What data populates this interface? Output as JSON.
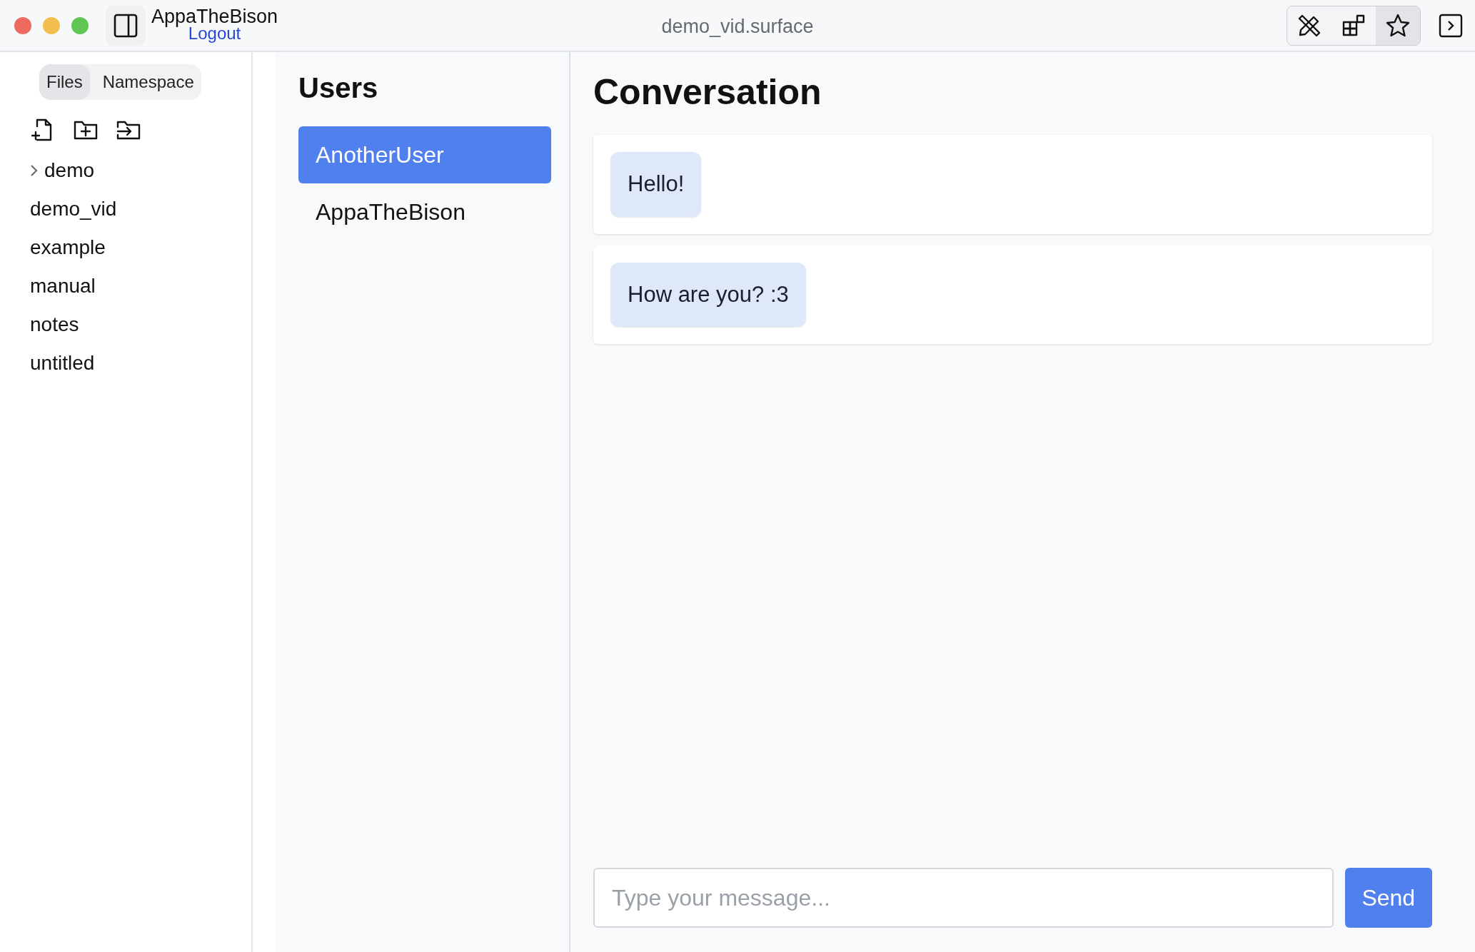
{
  "window": {
    "title": "demo_vid.surface"
  },
  "account": {
    "username": "AppaTheBison",
    "logout": "Logout"
  },
  "toolbar": [
    {
      "kind": "tools",
      "selected": false
    },
    {
      "kind": "widgets",
      "selected": false
    },
    {
      "kind": "star",
      "selected": true
    }
  ],
  "sidebar": {
    "tabs": [
      {
        "label": "Files",
        "selected": true
      },
      {
        "label": "Namespace",
        "selected": false
      }
    ],
    "actions": [
      {
        "kind": "new-file"
      },
      {
        "kind": "new-folder"
      },
      {
        "kind": "import"
      }
    ],
    "tree": [
      {
        "label": "demo",
        "kind": "folder",
        "expanded": false
      },
      {
        "label": "demo_vid",
        "kind": "file"
      },
      {
        "label": "example",
        "kind": "file"
      },
      {
        "label": "manual",
        "kind": "file"
      },
      {
        "label": "notes",
        "kind": "file"
      },
      {
        "label": "untitled",
        "kind": "file"
      }
    ]
  },
  "users": {
    "title": "Users",
    "items": [
      {
        "name": "AnotherUser",
        "selected": true
      },
      {
        "name": "AppaTheBison",
        "selected": false
      }
    ]
  },
  "conversation": {
    "title": "Conversation",
    "messages": [
      {
        "text": "Hello!"
      },
      {
        "text": "How are you? :3"
      }
    ],
    "composer": {
      "placeholder": "Type your message...",
      "button": "Send"
    }
  }
}
